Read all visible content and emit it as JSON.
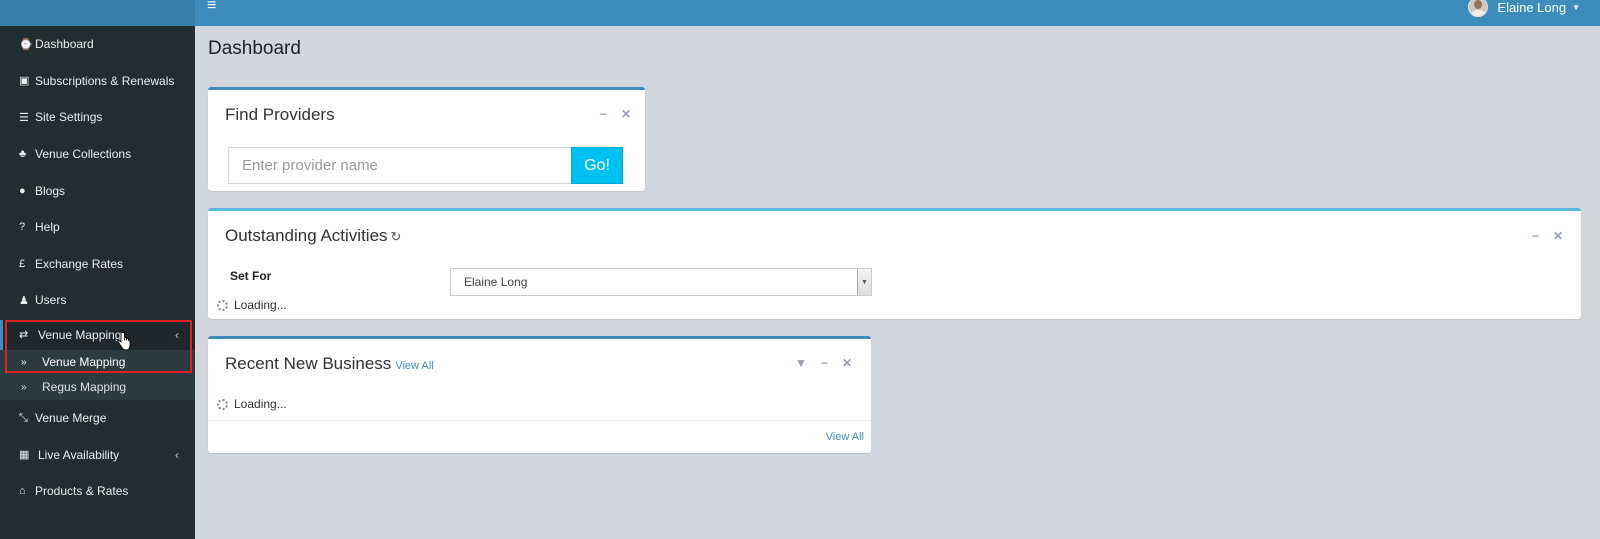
{
  "header": {
    "menu_toggle_icon": "hamburger-icon",
    "user_name": "Elaine Long",
    "brand_color": "#3c8dbc"
  },
  "sidebar": {
    "items": [
      {
        "label": "Dashboard",
        "icon": "dashboard-icon",
        "glyph": "⌚"
      },
      {
        "label": "Subscriptions & Renewals",
        "icon": "money-icon",
        "glyph": "▣"
      },
      {
        "label": "Site Settings",
        "icon": "list-icon",
        "glyph": "☰"
      },
      {
        "label": "Venue Collections",
        "icon": "sitemap-icon",
        "glyph": "♣"
      },
      {
        "label": "Blogs",
        "icon": "comment-icon",
        "glyph": "●"
      },
      {
        "label": "Help",
        "icon": "question-icon",
        "glyph": "?"
      },
      {
        "label": "Exchange Rates",
        "icon": "pound-icon",
        "glyph": "£"
      },
      {
        "label": "Users",
        "icon": "user-icon",
        "glyph": "♟"
      },
      {
        "label": "Venue Mapping",
        "icon": "exchange-icon",
        "glyph": "⇄"
      }
    ],
    "venue_mapping_submenu": [
      {
        "label": "Venue Mapping",
        "icon": "double-chevron-icon",
        "glyph": "»"
      },
      {
        "label": "Regus Mapping",
        "icon": "double-chevron-icon",
        "glyph": "»"
      }
    ],
    "items_after": [
      {
        "label": "Venue Merge",
        "icon": "compress-icon",
        "glyph": "⤡"
      },
      {
        "label": "Live Availability",
        "icon": "calendar-icon",
        "glyph": "▦"
      },
      {
        "label": "Products & Rates",
        "icon": "basket-icon",
        "glyph": "⌂"
      }
    ]
  },
  "main": {
    "page_title": "Dashboard",
    "find_providers": {
      "title": "Find Providers",
      "placeholder": "Enter provider name",
      "go_label": "Go!"
    },
    "outstanding": {
      "title": "Outstanding Activities",
      "set_for_label": "Set For",
      "set_for_value": "Elaine Long",
      "loading": "Loading..."
    },
    "recent": {
      "title": "Recent New Business",
      "view_all_header": "View All",
      "loading": "Loading...",
      "view_all_footer": "View All"
    }
  }
}
